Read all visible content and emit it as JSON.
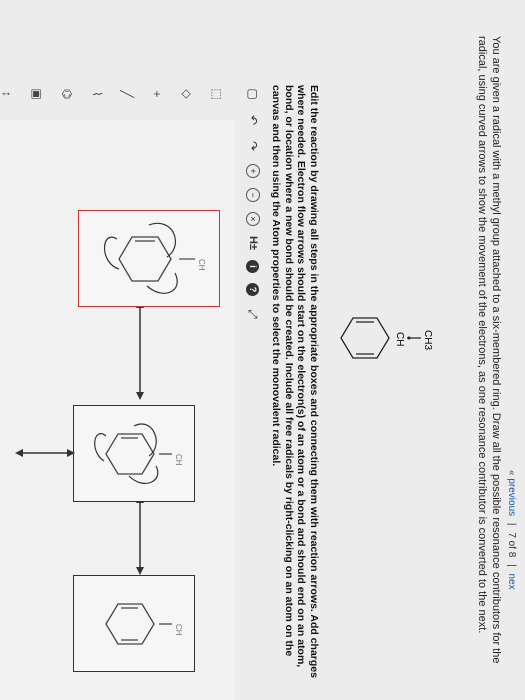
{
  "navigation": {
    "previous_label": "« previous",
    "page_indicator": "7 of 8",
    "next_label": "nex"
  },
  "question": {
    "text": "You are given a radical with a methyl group attached to a six-membered ring. Draw all the possible resonance contributors for the radical, using curved arrows to show the movement of the electrons, as one resonance contributor is converted to the next."
  },
  "molecule_labels": {
    "ch3": "CH3",
    "ch": "CH",
    "box_ch": "CH"
  },
  "instructions": {
    "text": "Edit the reaction by drawing all steps in the appropriate boxes and connecting them with reaction arrows. Add charges where needed. Electron flow arrows should start on the electron(s) of an atom or a bond and should end on an atom, bond, or location where a new bond should be created. Include all free radicals by right-clicking on an atom on the canvas and then using the Atom properties to select the monovalent radical."
  },
  "toolbar": {
    "new_icon": "document-icon",
    "undo_icon": "undo-icon",
    "redo_icon": "redo-icon",
    "plus_charge_label": "+",
    "minus_charge_label": "−",
    "close_label": "×",
    "h_label": "H±",
    "info_label": "i",
    "help_label": "?",
    "expand_icon": "expand-icon"
  },
  "left_tools": [
    "select-icon",
    "erase-icon",
    "add-icon",
    "bond-icon",
    "chain-icon",
    "ring-icon",
    "template-icon",
    "arrow-icon",
    "curved-arrow-icon"
  ]
}
